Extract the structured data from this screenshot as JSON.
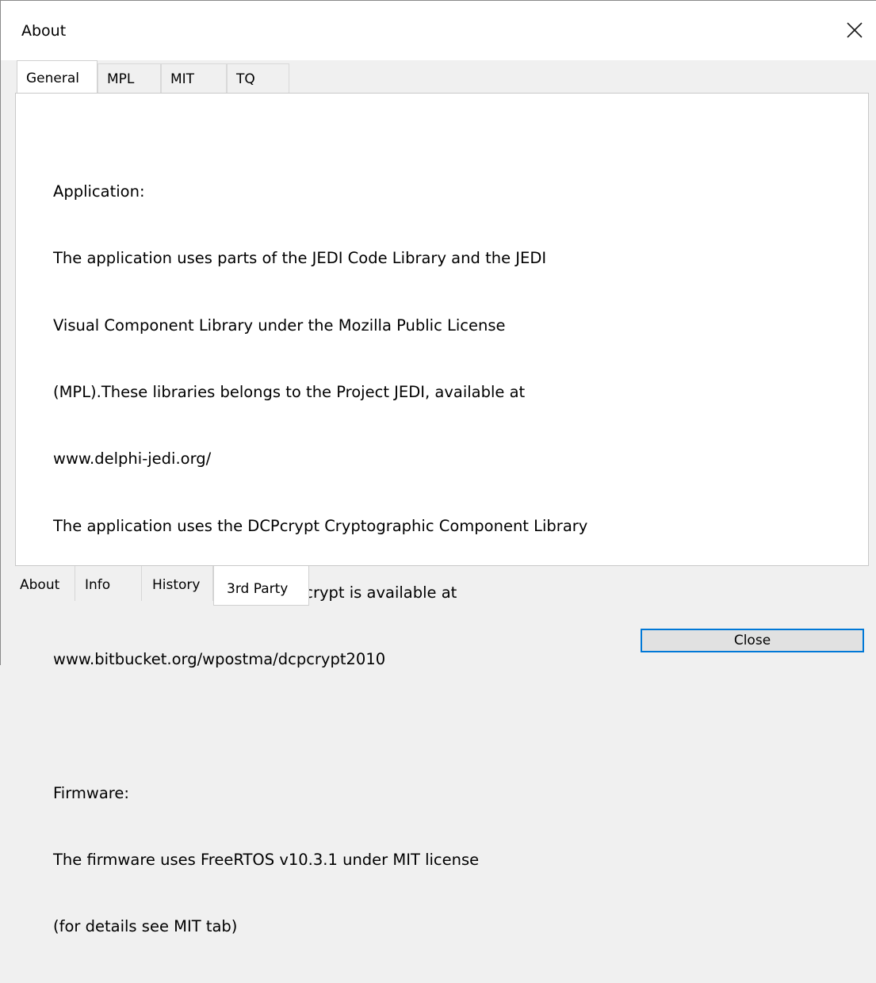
{
  "window": {
    "title": "About",
    "close_icon": "close-icon"
  },
  "top_tabs": [
    {
      "label": "General",
      "active": true
    },
    {
      "label": "MPL",
      "active": false
    },
    {
      "label": "MIT",
      "active": false
    },
    {
      "label": "TQ",
      "active": false
    }
  ],
  "content": {
    "lines": [
      "Application:",
      "The application uses parts of the JEDI Code Library and the JEDI",
      "Visual Component Library under the Mozilla Public License",
      "(MPL).These libraries belongs to the Project JEDI, available at",
      "www.delphi-jedi.org/",
      "The application uses the DCPcrypt Cryptographic Component Library",
      "v2.1 under the MIT License. DCPcrypt is available at",
      "www.bitbucket.org/wpostma/dcpcrypt2010",
      "",
      "Firmware:",
      "The firmware uses FreeRTOS v10.3.1 under MIT license",
      "(for details see MIT tab)"
    ]
  },
  "bottom_tabs": [
    {
      "label": "About",
      "active": false
    },
    {
      "label": "Info",
      "active": false
    },
    {
      "label": "History",
      "active": false
    },
    {
      "label": "3rd Party",
      "active": true
    }
  ],
  "buttons": {
    "close_label": "Close"
  },
  "colors": {
    "accent": "#0078d7",
    "background": "#f0f0f0",
    "panel": "#ffffff"
  }
}
